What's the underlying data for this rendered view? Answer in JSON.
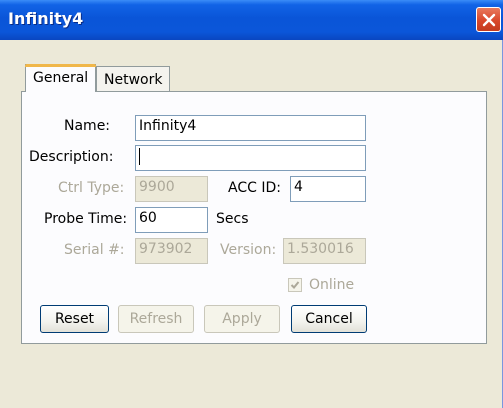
{
  "window": {
    "title": "Infinity4"
  },
  "tabs": [
    {
      "label": "General"
    },
    {
      "label": "Network"
    }
  ],
  "form": {
    "name": {
      "label": "Name:",
      "value": "Infinity4"
    },
    "description": {
      "label": "Description:",
      "value": ""
    },
    "ctrl_type": {
      "label": "Ctrl Type:",
      "value": "9900"
    },
    "acc_id": {
      "label": "ACC ID:",
      "value": "4"
    },
    "probe_time": {
      "label": "Probe Time:",
      "value": "60",
      "unit": "Secs"
    },
    "serial": {
      "label": "Serial #:",
      "value": "973902"
    },
    "version": {
      "label": "Version:",
      "value": "1.530016"
    },
    "online": {
      "label": "Online",
      "checked": true
    }
  },
  "buttons": {
    "reset": "Reset",
    "refresh": "Refresh",
    "apply": "Apply",
    "cancel": "Cancel"
  },
  "colors": {
    "titlebar": "#0a55d8",
    "close": "#d9482b",
    "face": "#ece9d8"
  },
  "icons": {
    "close": "close-icon",
    "check": "check-icon"
  }
}
